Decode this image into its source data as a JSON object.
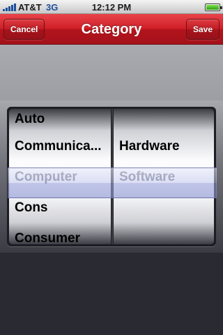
{
  "status_bar": {
    "carrier": "AT&T",
    "network": "3G",
    "time": "12:12 PM"
  },
  "nav": {
    "title": "Category",
    "cancel_label": "Cancel",
    "save_label": "Save"
  },
  "picker": {
    "left_column": [
      "Auto",
      "Communica...",
      "Computer",
      "Cons",
      "Consumer"
    ],
    "right_column": [
      "Hardware",
      "Software"
    ],
    "selected_left": "Computer",
    "selected_right": "Software"
  },
  "colors": {
    "nav_red": "#cf1d26",
    "selection_tint": "#a8aee0"
  }
}
